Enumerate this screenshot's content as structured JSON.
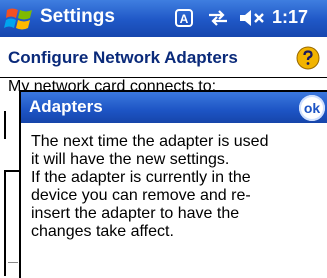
{
  "titlebar": {
    "app_title": "Settings",
    "time": "1:17",
    "icons": [
      "start-menu-icon",
      "input-indicator-icon",
      "connectivity-icon",
      "volume-off-icon"
    ]
  },
  "subheader": {
    "title": "Configure Network Adapters",
    "help_icon": "help-icon"
  },
  "background": {
    "label": "My network card connects to:"
  },
  "dialog": {
    "title": "Adapters",
    "ok_label": "ok",
    "message_lines": [
      "The next time the adapter is used",
      "it will have the new settings.",
      "If the adapter is currently in the",
      "device you can remove and re-",
      "insert the adapter to have the",
      "changes take affect."
    ]
  },
  "colors": {
    "titlebar": "#1f57c6",
    "subheader_text": "#0a2a7a",
    "dialog_header": "#1d54c4"
  }
}
